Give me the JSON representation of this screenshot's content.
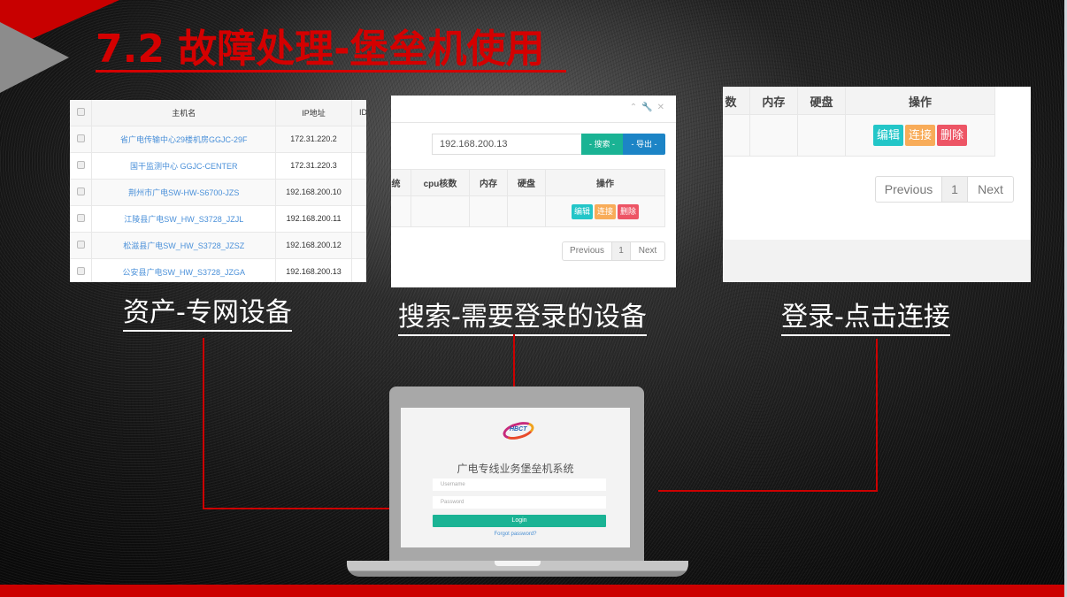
{
  "slide": {
    "title": "7.2 故障处理-堡垒机使用",
    "accent_color": "#cc0000"
  },
  "asset_panel": {
    "columns": [
      "",
      "主机名",
      "IP地址",
      "ID"
    ],
    "rows": [
      {
        "name": "省广电传输中心29楼机房GGJC-29F",
        "ip": "172.31.220.2"
      },
      {
        "name": "国干监测中心 GGJC-CENTER",
        "ip": "172.31.220.3"
      },
      {
        "name": "荆州市广电SW-HW-S6700-JZS",
        "ip": "192.168.200.10"
      },
      {
        "name": "江陵县广电SW_HW_S3728_JZJL",
        "ip": "192.168.200.11"
      },
      {
        "name": "松滋县广电SW_HW_S3728_JZSZ",
        "ip": "192.168.200.12"
      },
      {
        "name": "公安县广电SW_HW_S3728_JZGA",
        "ip": "192.168.200.13"
      }
    ],
    "caption": "资产-专网设备"
  },
  "search_panel": {
    "toolbar_icons": [
      "chevron-up-icon",
      "wrench-icon",
      "close-icon"
    ],
    "search_value": "192.168.200.13",
    "search_button": "- 搜索 -",
    "export_button": "- 导出 -",
    "columns": [
      "统",
      "cpu核数",
      "内存",
      "硬盘",
      "操作"
    ],
    "actions": {
      "edit": "编辑",
      "connect": "连接",
      "delete": "删除"
    },
    "pagination": {
      "previous": "Previous",
      "current": "1",
      "next": "Next"
    },
    "caption": "搜索-需要登录的设备"
  },
  "connect_panel": {
    "columns": [
      "数",
      "内存",
      "硬盘",
      "操作"
    ],
    "actions": {
      "edit": "编辑",
      "connect": "连接",
      "delete": "删除"
    },
    "pagination": {
      "previous": "Previous",
      "current": "1",
      "next": "Next"
    },
    "caption": "登录-点击连接"
  },
  "laptop_login": {
    "logo_text": "HBCT",
    "system_title": "广电专线业务堡垒机系统",
    "username_placeholder": "Username",
    "password_placeholder": "Password",
    "login_button": "Login",
    "forgot_link": "Forgot password?"
  }
}
